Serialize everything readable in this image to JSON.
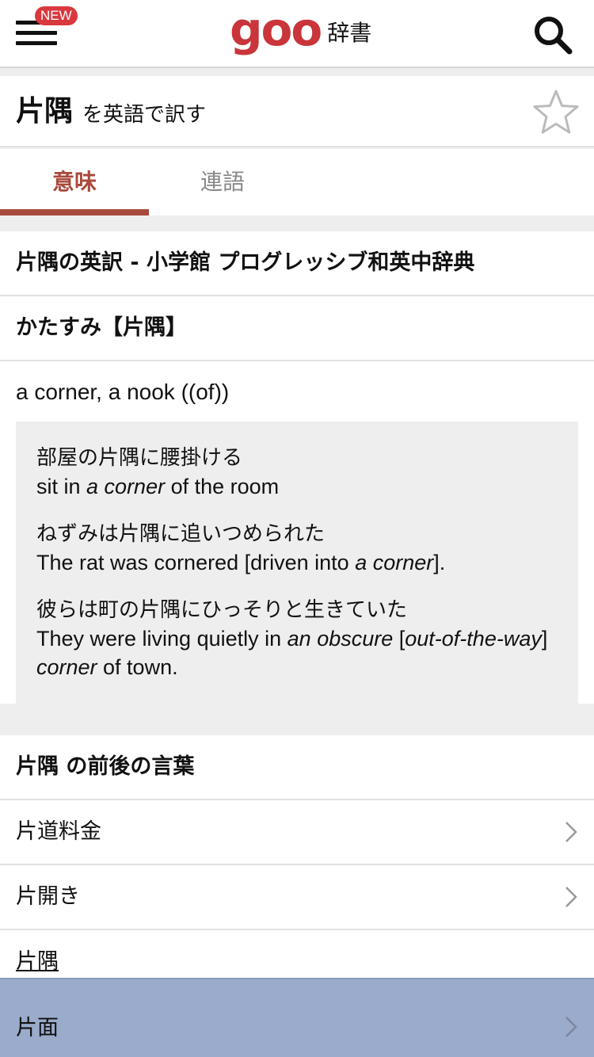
{
  "header": {
    "new_badge": "NEW",
    "logo_text": "goo",
    "logo_suffix": "辞書",
    "accent_color": "#c9353a"
  },
  "title": {
    "word": "片隅",
    "suffix": "を英語で訳す"
  },
  "tabs": [
    {
      "label": "意味",
      "active": true
    },
    {
      "label": "連語",
      "active": false
    }
  ],
  "entry": {
    "source_heading": "片隅の英訳 - 小学館 プログレッシブ和英中辞典",
    "reading": "かたすみ【片隅】",
    "definition": "a corner, a nook ((of))",
    "examples": [
      {
        "ja": "部屋の片隅に腰掛ける",
        "en_parts": [
          "sit in ",
          "a corner",
          " of the room"
        ]
      },
      {
        "ja": "ねずみは片隅に追いつめられた",
        "en_parts": [
          "The rat was cornered [driven into ",
          "a corner",
          "]."
        ]
      },
      {
        "ja": "彼らは町の片隅にひっそりと生きていた",
        "en_parts": [
          "They were living quietly in ",
          "an obscure",
          " [",
          "out-of-the-way",
          "] ",
          "corner",
          " of town."
        ]
      }
    ]
  },
  "nearby": {
    "heading": "片隅 の前後の言葉",
    "items": [
      {
        "label": "片道料金",
        "has_chevron": true
      },
      {
        "label": "片開き",
        "has_chevron": true
      },
      {
        "label": "片隅",
        "has_chevron": false,
        "current": true
      },
      {
        "label": "片面",
        "has_chevron": true,
        "highlighted": true
      }
    ]
  }
}
